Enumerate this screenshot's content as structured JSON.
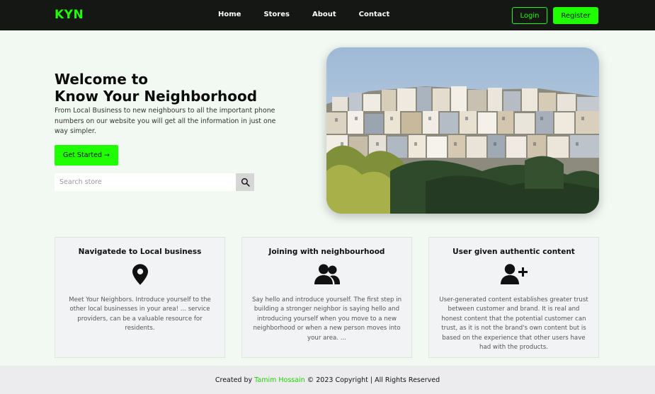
{
  "nav": {
    "logo": "KYN",
    "links": [
      "Home",
      "Stores",
      "About",
      "Contact"
    ],
    "login_label": "Login",
    "register_label": "Register"
  },
  "hero": {
    "title_line1": "Welcome to",
    "title_line2": "Know Your Neighborhood",
    "description": "From Local Business to new neighbours to all the important phone numbers on our website you will get all the information in just one way simpler.",
    "cta_label": "Get Started →",
    "search_placeholder": "Search store"
  },
  "cards": [
    {
      "title": "Navigatede to Local business",
      "icon": "location-pin-icon",
      "text": "Meet Your Neighbors. Introduce yourself to the other local businesses in your area! ... service providers, can be a valuable resource for residents."
    },
    {
      "title": "Joining with neighbourhood",
      "icon": "users-icon",
      "text": "Say hello and introduce yourself. The first step in building a stronger neighbor is saying hello and introducing yourself when you move to a new neighborhood or when a new person moves into your area. ..."
    },
    {
      "title": "User given authentic content",
      "icon": "user-plus-icon",
      "text": "User-generated content establishes greater trust between customer and brand. It is real and honest content that the potential customer can trust, as it is not the brand's own content but is based on the experience that other users have had with the products."
    }
  ],
  "footer": {
    "prefix": "Created by ",
    "author": "Tamim Hossain",
    "suffix": " © 2023 Copyright | All Rights Reserved"
  },
  "colors": {
    "accent": "#1fff00",
    "navbar_bg": "#141714",
    "page_bg": "#f2f9f3"
  }
}
